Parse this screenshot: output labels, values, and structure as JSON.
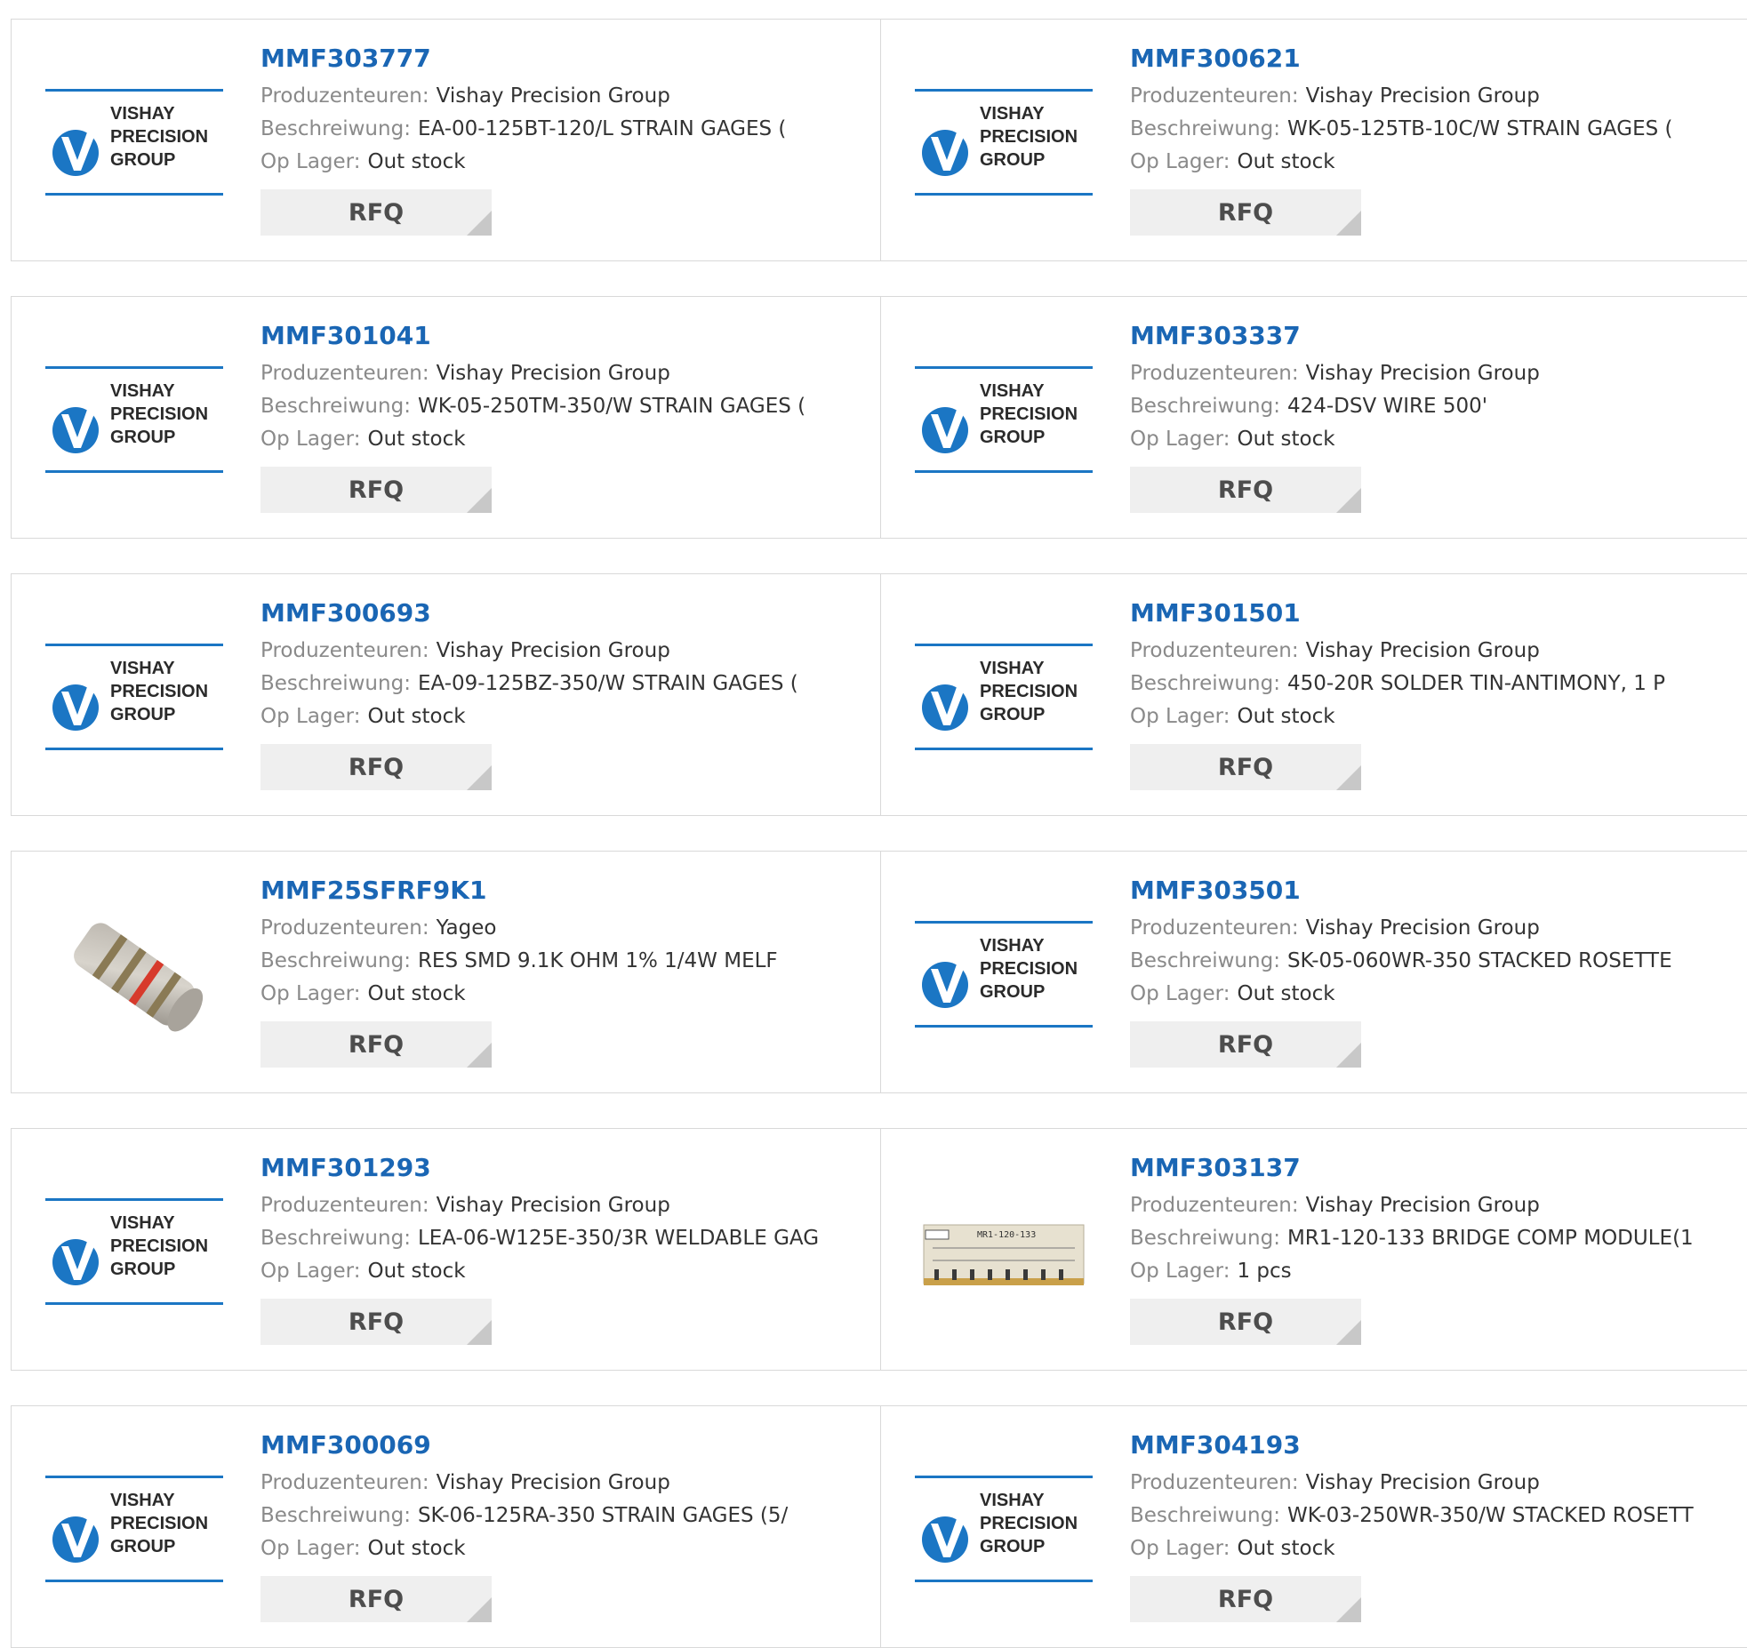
{
  "labels": {
    "manufacturer": "Produzenteuren:",
    "description": "Beschreiwung:",
    "stock": "Op Lager:"
  },
  "rfq_label": "RFQ",
  "logo": {
    "line1": "VISHAY",
    "line2": "PRECISION",
    "line3": "GROUP"
  },
  "colors": {
    "link": "#1a66b4",
    "logo_blue": "#1b76c4",
    "rfq_bg": "#efefef",
    "border": "#d9d9d9"
  },
  "products": [
    {
      "part": "MMF303777",
      "manufacturer": "Vishay Precision Group",
      "description": "EA-00-125BT-120/L STRAIN GAGES (",
      "stock": "Out stock",
      "image": "vishay-logo"
    },
    {
      "part": "MMF300621",
      "manufacturer": "Vishay Precision Group",
      "description": "WK-05-125TB-10C/W STRAIN GAGES (",
      "stock": "Out stock",
      "image": "vishay-logo"
    },
    {
      "part": "MMF301041",
      "manufacturer": "Vishay Precision Group",
      "description": "WK-05-250TM-350/W STRAIN GAGES (",
      "stock": "Out stock",
      "image": "vishay-logo"
    },
    {
      "part": "MMF303337",
      "manufacturer": "Vishay Precision Group",
      "description": "424-DSV WIRE 500'",
      "stock": "Out stock",
      "image": "vishay-logo"
    },
    {
      "part": "MMF300693",
      "manufacturer": "Vishay Precision Group",
      "description": "EA-09-125BZ-350/W STRAIN GAGES (",
      "stock": "Out stock",
      "image": "vishay-logo"
    },
    {
      "part": "MMF301501",
      "manufacturer": "Vishay Precision Group",
      "description": "450-20R SOLDER TIN-ANTIMONY, 1 P",
      "stock": "Out stock",
      "image": "vishay-logo"
    },
    {
      "part": "MMF25SFRF9K1",
      "manufacturer": "Yageo",
      "description": "RES SMD 9.1K OHM 1% 1/4W MELF",
      "stock": "Out stock",
      "image": "melf-resistor"
    },
    {
      "part": "MMF303501",
      "manufacturer": "Vishay Precision Group",
      "description": "SK-05-060WR-350 STACKED ROSETTE",
      "stock": "Out stock",
      "image": "vishay-logo"
    },
    {
      "part": "MMF301293",
      "manufacturer": "Vishay Precision Group",
      "description": "LEA-06-W125E-350/3R WELDABLE GAG",
      "stock": "Out stock",
      "image": "vishay-logo"
    },
    {
      "part": "MMF303137",
      "manufacturer": "Vishay Precision Group",
      "description": "MR1-120-133 BRIDGE COMP MODULE(1",
      "stock": "1 pcs",
      "image": "bridge-module",
      "module_text": "MR1-120-133"
    },
    {
      "part": "MMF300069",
      "manufacturer": "Vishay Precision Group",
      "description": "SK-06-125RA-350 STRAIN GAGES (5/",
      "stock": "Out stock",
      "image": "vishay-logo"
    },
    {
      "part": "MMF304193",
      "manufacturer": "Vishay Precision Group",
      "description": "WK-03-250WR-350/W STACKED ROSETT",
      "stock": "Out stock",
      "image": "vishay-logo"
    }
  ]
}
